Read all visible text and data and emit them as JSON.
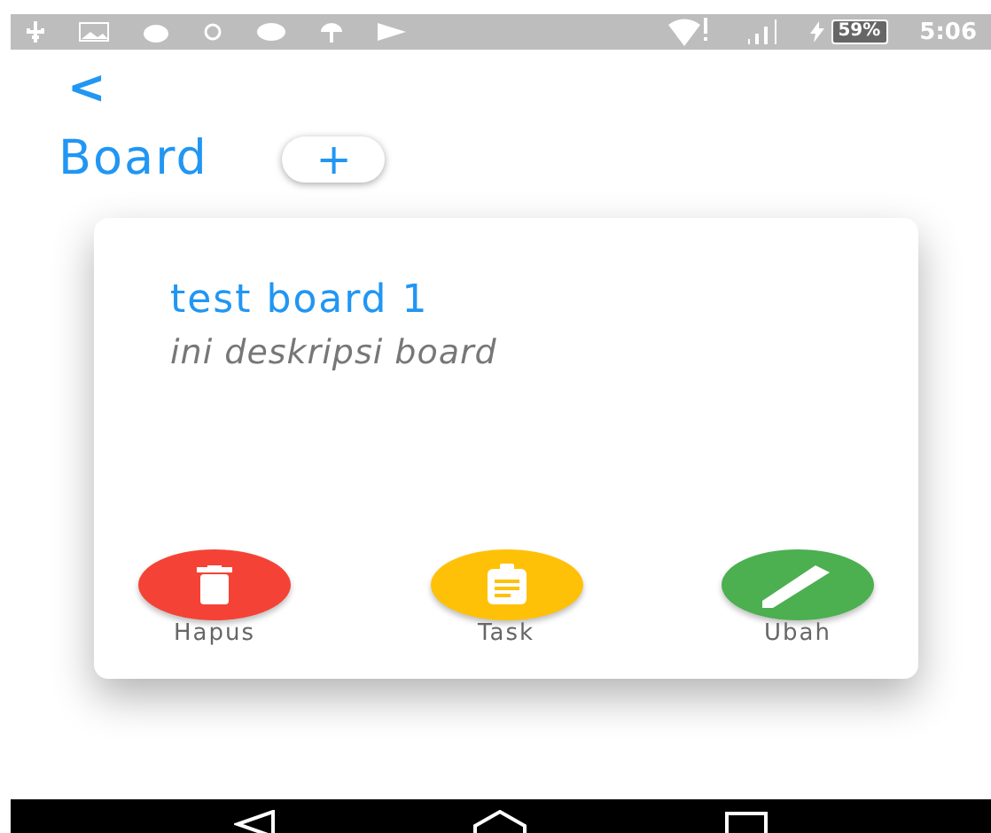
{
  "status_bar": {
    "battery": "59%",
    "time": "5:06"
  },
  "header": {
    "back": "<",
    "title": "Board",
    "add": "+"
  },
  "boards": [
    {
      "title": "test board 1",
      "description": "ini deskripsi board",
      "actions": [
        {
          "kind": "delete",
          "label": "Hapus",
          "color": "#f44336"
        },
        {
          "kind": "task",
          "label": "Task",
          "color": "#ffc107"
        },
        {
          "kind": "edit",
          "label": "Ubah",
          "color": "#4caf50"
        }
      ]
    }
  ]
}
